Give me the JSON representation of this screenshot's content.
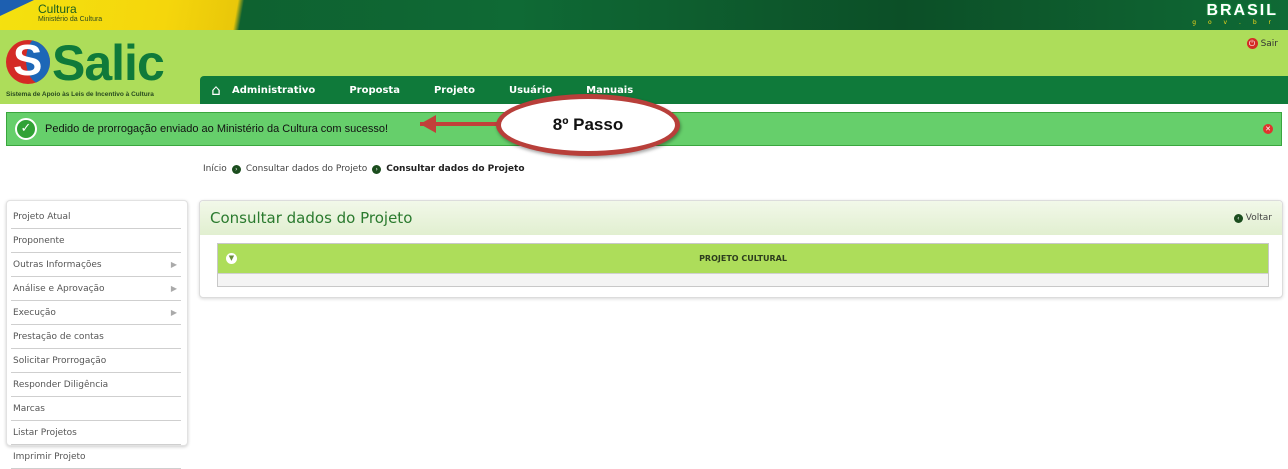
{
  "gov_bar": {
    "title": "Cultura",
    "subtitle": "Ministério da Cultura",
    "brasil": "BRASIL",
    "gov_br": "g o v . b r"
  },
  "header": {
    "logo_text": "Salic",
    "logo_tagline": "Sistema de Apoio às Leis de Incentivo à Cultura",
    "sair_label": "Sair"
  },
  "nav": {
    "items": [
      "Administrativo",
      "Proposta",
      "Projeto",
      "Usuário",
      "Manuais"
    ]
  },
  "message": {
    "text": "Pedido de prorrogação enviado ao Ministério da Cultura com sucesso!"
  },
  "annotation": {
    "label": "8º Passo"
  },
  "breadcrumb": {
    "home": "Início",
    "level1": "Consultar dados do Projeto",
    "current": "Consultar dados do Projeto"
  },
  "sidebar": {
    "items": [
      {
        "label": "Projeto Atual",
        "has_children": false
      },
      {
        "label": "Proponente",
        "has_children": false
      },
      {
        "label": "Outras Informações",
        "has_children": true
      },
      {
        "label": "Análise e Aprovação",
        "has_children": true
      },
      {
        "label": "Execução",
        "has_children": true
      },
      {
        "label": "Prestação de contas",
        "has_children": false
      },
      {
        "label": "Solicitar Prorrogação",
        "has_children": false
      },
      {
        "label": "Responder Diligência",
        "has_children": false
      },
      {
        "label": "Marcas",
        "has_children": false
      },
      {
        "label": "Listar Projetos",
        "has_children": false
      },
      {
        "label": "Imprimir Projeto",
        "has_children": false
      }
    ]
  },
  "panel": {
    "title": "Consultar dados do Projeto",
    "back_label": "Voltar",
    "section_title": "PROJETO CULTURAL"
  },
  "colors": {
    "brand_green": "#0f7a3a",
    "header_green": "#addd5a",
    "success_green": "#66cf6b",
    "annotation_red": "#b83f3a"
  }
}
